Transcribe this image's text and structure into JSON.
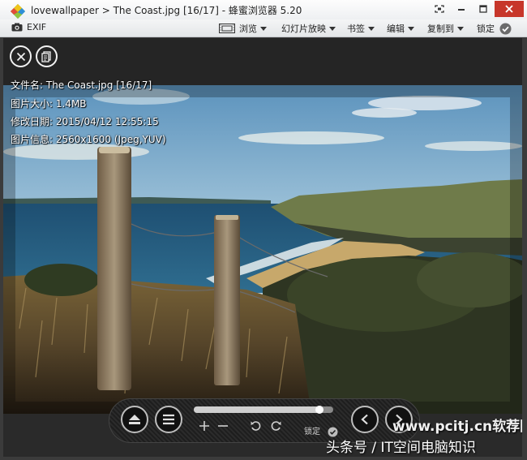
{
  "window": {
    "title": "lovewallpaper > The Coast.jpg [16/17] - 蜂蜜浏览器 5.20"
  },
  "menubar": {
    "exif": "EXIF",
    "browse": "浏览",
    "slideshow": "幻灯片放映",
    "bookmarks": "书签",
    "edit": "编辑",
    "copy_to": "复制到",
    "lock": "锁定"
  },
  "info": {
    "filename": "文件名: The Coast.jpg [16/17]",
    "size": "图片大小: 1.4MB",
    "modified": "修改日期: 2015/04/12 12:55:15",
    "details": "图片信息: 2560x1600 (Jpeg,YUV)"
  },
  "controls": {
    "lock": "锁定",
    "zoom_progress": 0.9
  },
  "watermark": {
    "site": "www.pcitj.cn软荐网",
    "source": "头条号 / IT空间电脑知识"
  },
  "icons": {
    "close": "close-icon",
    "info": "info-icon",
    "eject": "eject-icon",
    "menu": "menu-icon",
    "zoom_in": "zoom-in-icon",
    "zoom_out": "zoom-out-icon",
    "rotate_left": "rotate-left-icon",
    "rotate_right": "rotate-right-icon",
    "check": "check-icon",
    "prev": "chevron-left-icon",
    "next": "chevron-right-icon"
  },
  "colors": {
    "chrome_bg": "#f0f1f3",
    "viewer_bg": "#252525",
    "accent_check": "#6b6b6b"
  }
}
